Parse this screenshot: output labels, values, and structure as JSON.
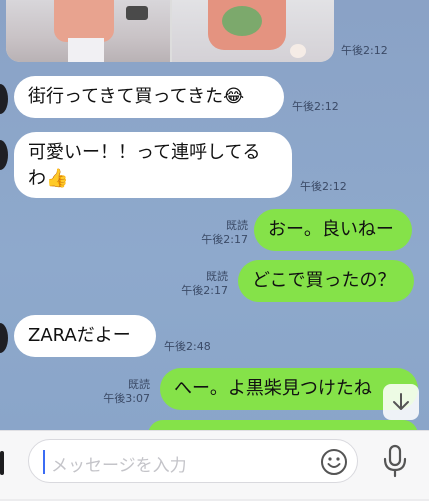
{
  "messages": [
    {
      "id": "m1",
      "side": "in",
      "text": "街行ってきて買ってきた😂",
      "time": "午後2:12"
    },
    {
      "id": "m2",
      "side": "in",
      "line1": "可愛いー！！って連呼してる",
      "line2": "わ👍",
      "time": "午後2:12"
    },
    {
      "id": "m3",
      "side": "out",
      "text": "おー。良いねー",
      "read": "既読",
      "time": "午後2:17"
    },
    {
      "id": "m4",
      "side": "out",
      "text": "どこで買ったの？",
      "read": "既読",
      "time": "午後2:17"
    },
    {
      "id": "m5",
      "side": "in",
      "text": "ZARAだよー",
      "time": "午後2:48"
    },
    {
      "id": "m6",
      "side": "out",
      "text": "へー。よ黒柴見つけたね",
      "read": "既読",
      "time": "午後3:07"
    }
  ],
  "photo_time": "午後2:12",
  "input": {
    "placeholder": "メッセージを入力"
  },
  "icons": {
    "scroll": "arrow-down-icon",
    "emoji": "smiley-icon",
    "mic": "microphone-icon"
  },
  "colors": {
    "incoming": "#ffffff",
    "outgoing": "#85e249",
    "background": "#8ea6c9"
  }
}
